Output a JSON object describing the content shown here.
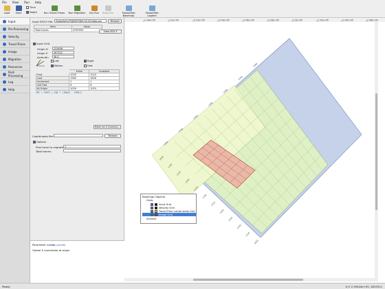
{
  "menu": [
    "File",
    "View",
    "Run",
    "Help"
  ],
  "toolbar": {
    "load": "Load",
    "save": "Save",
    "time": "Time",
    "depth": "Depth",
    "run_travel_times": "Run Travel-Times",
    "run_migration": "Run Migration",
    "dry_run": "Dry Run",
    "stop_run": "Stop Run",
    "show_hide_basemap": "Show/Hide Basemap",
    "show_hide_legend": "Show/Hide Legend"
  },
  "sidebar": [
    "Input",
    "Pre-Processing",
    "Velocity",
    "Travel-Times",
    "Image",
    "Migration",
    "Resources",
    "Post-Processing",
    "Log",
    "Help"
  ],
  "form": {
    "segy_label": "Input SEG-Y file:",
    "segy_value": "/Data/Kelly/PSDM/PSDM.OS.05/data.sgy",
    "browse": "Browse",
    "item_header": "Item",
    "value_header": "Value",
    "total_traces_label": "Total traces",
    "total_traces_value": "4790994",
    "view_segy": "View SEG-Y",
    "input_grid": "Input Grid",
    "origin_x_label": "Origin X:",
    "origin_x_value": "233636",
    "origin_y_label": "Origin Y:",
    "origin_y_value": "267522",
    "azimuth_label": "Azimuth:",
    "azimuth_value": "48.4",
    "left": "Left",
    "right": "Right",
    "meters": "Meters",
    "feet": "Feet",
    "col_inline": "Inline",
    "col_crossline": "Crossline",
    "rows": [
      {
        "label": "First",
        "inline": "1026",
        "crossline": "1024"
      },
      {
        "label": "Last",
        "inline": "1980",
        "crossline": "1826"
      },
      {
        "label": "Increment",
        "inline": "1",
        "crossline": "1"
      },
      {
        "label": "Cell Size",
        "inline": "6",
        "crossline": "6"
      },
      {
        "label": "At Origin",
        "inline": "1026",
        "crossline": "1024"
      }
    ],
    "note": "TRC = FIRST + INC * (TRACE - FIRST)",
    "enter_corners": "Enter as 3 Corners...",
    "coords_file_label": "Coordinates file:",
    "browse2": "Browse",
    "options": "Options",
    "first_trace_label": "First trace to migrate:",
    "first_trace_value": "1",
    "total_traces2_label": "Total traces:",
    "total_traces2_value": ""
  },
  "help": {
    "param_label": "Parameter name:",
    "param_value": "xn_survey",
    "description": "Global X coordinate at origin"
  },
  "map": {
    "ruler_labels": [
      "2.18e+05",
      "2.2e+05",
      "2.22e+05",
      "2.24e+05",
      "2.26e+05",
      "2.28e+05",
      "2.3e+05",
      "2.32e+05",
      "2.34e+05",
      "2.36e+05"
    ],
    "inline_ticks": [
      "1026",
      "1100",
      "1150",
      "1200",
      "1250",
      "1300",
      "1350",
      "1400",
      "1450",
      "1500",
      "1550",
      "1600"
    ],
    "crossline_ticks": [
      "1024",
      "1100",
      "1200",
      "1300",
      "1400",
      "1500",
      "1600"
    ],
    "colors": {
      "input_grid": "#c6d2ea",
      "velocity_grid": "#dff0c6",
      "tt_grid": "#eef7cf",
      "image_grid": "#e8b9a8"
    }
  },
  "legend": {
    "title": "Basemap Objects",
    "items": [
      {
        "label": "Grids",
        "color": ""
      },
      {
        "label": "Input Grid",
        "color": "#000000"
      },
      {
        "label": "Velocity Grid",
        "color": "#000000"
      },
      {
        "label": "Travel-Time virtual shots Grid",
        "color": "#f0e000"
      },
      {
        "label": "Image Grid",
        "color": "#e03030"
      },
      {
        "label": "Surveys",
        "color": ""
      }
    ]
  },
  "status": {
    "left": "Ready",
    "right": "X,Y: 2.39444e+05, 2615511"
  }
}
